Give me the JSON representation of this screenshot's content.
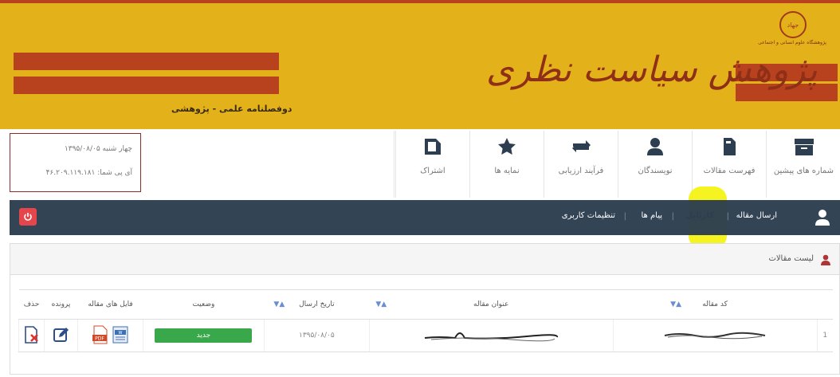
{
  "banner": {
    "title": "پژوهش سیاست نظری",
    "subtitle": "دوفصلنامه علمی - پژوهشی",
    "logo_seal": "جهاد",
    "logo_text": "پژوهشگاه علوم انسانی و اجتماعی",
    "colors": {
      "background": "#e3b21b",
      "stripe": "#b9421e",
      "title": "#8f2f17"
    }
  },
  "info": {
    "date": "چهار شنبه ۱۳۹۵/۰۸/۰۵",
    "ip": "آی پی شما: ۴۶.۲۰۹.۱۱۹.۱۸۱"
  },
  "topnav": [
    {
      "label": "شماره های پیشین",
      "icon": "archive-icon"
    },
    {
      "label": "فهرست مقالات",
      "icon": "document-icon"
    },
    {
      "label": "نویسندگان",
      "icon": "user-icon"
    },
    {
      "label": "فرآیند ارزیابی",
      "icon": "exchange-icon"
    },
    {
      "label": "نمایه ها",
      "icon": "star-icon"
    },
    {
      "label": "اشتراک",
      "icon": "subscription-icon"
    }
  ],
  "darkbar": {
    "items": [
      "ارسال مقاله",
      "کارتابل",
      "پیام ها",
      "تنظیمات کاربری"
    ],
    "active": "کارتابل",
    "power_icon": "power-icon",
    "colors": {
      "background": "#2c3e50",
      "power": "#e5464b",
      "highlight": "#f4f30e"
    }
  },
  "panel": {
    "title": "لیست مقالات",
    "columns": [
      "کد مقاله",
      "عنوان مقاله",
      "تاریخ ارسال",
      "وضعیت",
      "فایل های مقاله",
      "پرونده",
      "حذف"
    ],
    "rows": [
      {
        "index": "1",
        "code": "",
        "title": "",
        "date": "۱۳۹۵/۰۸/۰۵",
        "status": "جدید"
      }
    ],
    "status_color": "#39a84a"
  }
}
